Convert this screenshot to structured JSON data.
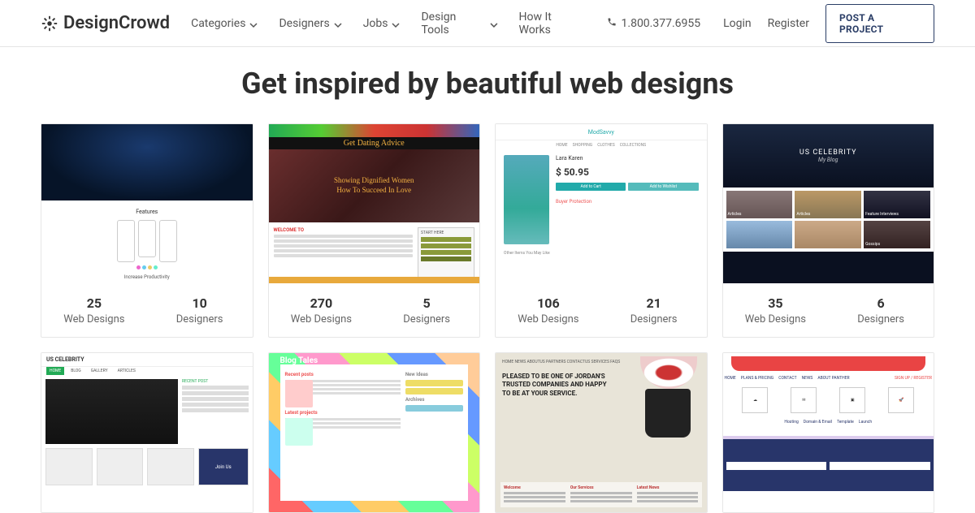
{
  "brand": "DesignCrowd",
  "nav": {
    "categories": "Categories",
    "designers": "Designers",
    "jobs": "Jobs",
    "design_tools": "Design Tools",
    "how_it_works": "How It Works"
  },
  "phone": "1.800.377.6955",
  "auth": {
    "login": "Login",
    "register": "Register",
    "post": "POST A PROJECT"
  },
  "hero": "Get inspired by beautiful web designs",
  "labels": {
    "designs": "Web Designs",
    "designers": "Designers"
  },
  "cards": [
    {
      "designs": "25",
      "designers": "10"
    },
    {
      "designs": "270",
      "designers": "5"
    },
    {
      "designs": "106",
      "designers": "21"
    },
    {
      "designs": "35",
      "designers": "6"
    }
  ],
  "thumbs": {
    "t1": {
      "features": "Features",
      "footer": "Increase Productivity"
    },
    "t2": {
      "title": "Get Dating Advice",
      "tagline1": "Showing Dignified Women",
      "tagline2": "How To Succeed In Love",
      "welcome": "WELCOME TO",
      "start": "START HERE"
    },
    "t3": {
      "brand": "ModSavvy",
      "name": "Lara Karen",
      "price": "$ 50.95",
      "add_cart": "Add to Cart",
      "add_wish": "Add to Wishlist",
      "buyer": "Buyer Protection",
      "other": "Other Items You May Like"
    },
    "t4": {
      "title": "US CELEBRITY",
      "sub": "My Blog",
      "labels": [
        "Articles",
        "Articles",
        "Feature Interviews",
        "",
        "",
        "Gossips",
        "",
        ""
      ]
    },
    "t5": {
      "brand": "US CELEBRITY",
      "tabs": [
        "HOME",
        "BLOG",
        "GALLERY",
        "ARTICLES"
      ],
      "recent": "RECENT POST",
      "join": "Join Us"
    },
    "t6": {
      "title": "Blog Tales",
      "recent": "Recent posts",
      "ideas": "New Ideas",
      "latest": "Latest projects",
      "archives": "Archives"
    },
    "t7": {
      "nav": "HOME  NEWS  ABOUTUS  PARTNERS  CONTACTUS  SERVICES  FAQS",
      "headline": "PLEASED TO BE ONE OF JORDAN'S TRUSTED COMPANIES AND HAPPY TO BE AT YOUR SERVICE.",
      "cols": [
        "Welcome",
        "Our Services",
        "Latest News"
      ]
    },
    "t8": {
      "nav": [
        "HOME",
        "PLANS & PRICING",
        "CONTACT",
        "NEWS",
        "ABOUT PANTHER"
      ],
      "signup": "SIGN UP / REGISTER",
      "icons": [
        "Hosting",
        "Domain & Email",
        "Template",
        "Launch"
      ]
    }
  }
}
